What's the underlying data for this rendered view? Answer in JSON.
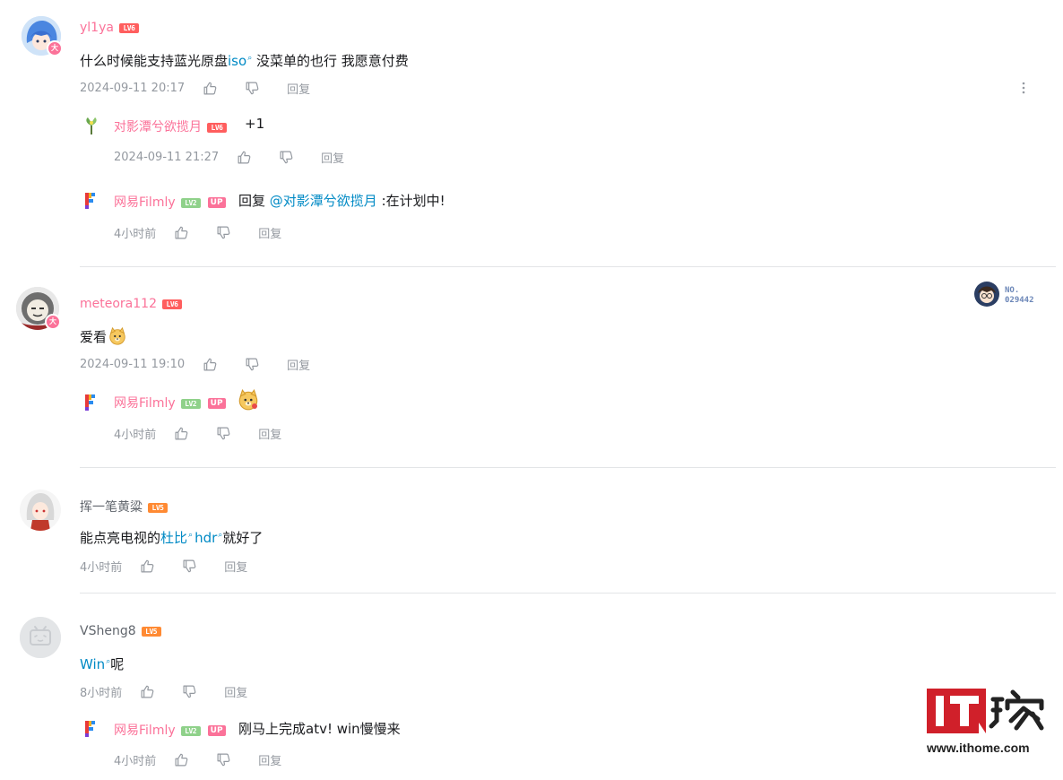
{
  "comments": [
    {
      "username": "yl1ya",
      "level": "LV6",
      "text_pre": "什么时候能支持蓝光原盘",
      "link": "iso",
      "text_post": " 没菜单的也行 我愿意付费",
      "time": "2024-09-11 20:17",
      "reply_label": "回复",
      "more_icon": "more-vertical-icon",
      "replies": [
        {
          "username": "对影潭兮欲揽月",
          "level": "LV6",
          "text": "+1",
          "time": "2024-09-11 21:27",
          "reply_label": "回复"
        },
        {
          "username": "网易Filmly",
          "level": "LV2",
          "badge": "UP",
          "text_pre": "回复 ",
          "mention": "@对影潭兮欲揽月",
          "text_post": " :在计划中!",
          "time": "4小时前",
          "reply_label": "回复"
        }
      ]
    },
    {
      "username": "meteora112",
      "level": "LV6",
      "text": "爱看",
      "time": "2024-09-11 19:10",
      "reply_label": "回复",
      "fan_badge": {
        "label": "NO.",
        "number": "029442"
      },
      "replies": [
        {
          "username": "网易Filmly",
          "level": "LV2",
          "badge": "UP",
          "time": "4小时前",
          "reply_label": "回复"
        }
      ]
    },
    {
      "username": "挥一笔黄粱",
      "level": "LV5",
      "text_pre": "能点亮电视的",
      "link1": "杜比",
      "link2": "hdr",
      "text_post": "就好了",
      "time": "4小时前",
      "reply_label": "回复"
    },
    {
      "username": "VSheng8",
      "level": "LV5",
      "link": "Win",
      "text_post": "呢",
      "time": "8小时前",
      "reply_label": "回复",
      "replies": [
        {
          "username": "网易Filmly",
          "level": "LV2",
          "badge": "UP",
          "text": "刚马上完成atv!  win慢慢来",
          "time": "4小时前",
          "reply_label": "回复"
        }
      ]
    }
  ],
  "watermark": {
    "brand": "IT之家",
    "url": "www.ithome.com"
  },
  "colors": {
    "pink": "#fb7299",
    "link": "#008ac5",
    "meta": "#9499a0",
    "divider": "#e3e5e7",
    "lv6": "#ff5e5e",
    "lv5": "#ff8a33",
    "lv2": "#8fd18a",
    "it_red": "#d0202a"
  }
}
